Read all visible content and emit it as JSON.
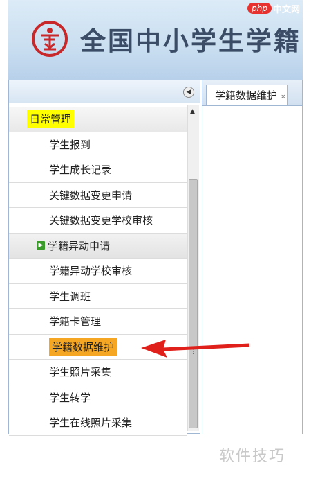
{
  "header": {
    "title": "全国中小学生学籍",
    "watermark_brand": "php",
    "watermark_site": "中文网"
  },
  "left_panel": {
    "collapse_icon": "collapse-left-icon",
    "menu": [
      {
        "label": "日常管理",
        "type": "group",
        "highlight": "#ffff00"
      },
      {
        "label": "学生报到",
        "type": "item"
      },
      {
        "label": "学生成长记录",
        "type": "item"
      },
      {
        "label": "关键数据变更申请",
        "type": "item"
      },
      {
        "label": "关键数据变更学校审核",
        "type": "item"
      },
      {
        "label": "学籍异动申请",
        "type": "selected"
      },
      {
        "label": "学籍异动学校审核",
        "type": "item"
      },
      {
        "label": "学生调班",
        "type": "item"
      },
      {
        "label": "学籍卡管理",
        "type": "item"
      },
      {
        "label": "学籍数据维护",
        "type": "item",
        "highlight": "#f5a623"
      },
      {
        "label": "学生照片采集",
        "type": "item"
      },
      {
        "label": "学生转学",
        "type": "item"
      },
      {
        "label": "学生在线照片采集",
        "type": "item"
      }
    ]
  },
  "right_panel": {
    "tab_label": "学籍数据维护"
  },
  "footer": {
    "watermark": "软件技巧"
  },
  "colors": {
    "header_blue": "#c9def0",
    "highlight_yellow": "#ffff00",
    "highlight_orange": "#f5a623",
    "arrow_red": "#e0201a",
    "logo_red": "#c8282a"
  }
}
